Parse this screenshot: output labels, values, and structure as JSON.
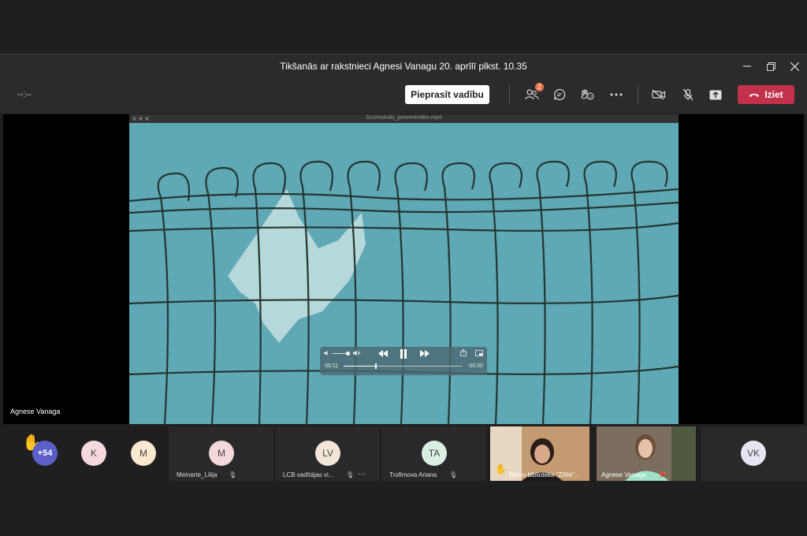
{
  "window": {
    "title": "Tikšanās ar rakstnieci Agnesi Vanagu 20. aprīlī plkst. 10.35"
  },
  "toolbar": {
    "timer": "--:--",
    "request_control_label": "Pieprasīt vadību",
    "participants_badge": "2",
    "leave_label": "Iziet"
  },
  "stage": {
    "video_filename": "Duzmukulis_prezentvideo.mp4",
    "elapsed": "00:11",
    "remaining": "-00:30",
    "progress": 0.27,
    "presenter_name": "Agnese Vanaga"
  },
  "participants": {
    "overflow_count": "+54",
    "tiles": [
      {
        "initials": "K"
      },
      {
        "initials": "M"
      },
      {
        "initials": "M",
        "name": "Meinerte_Lilija"
      },
      {
        "initials": "LV",
        "name": "LCB vadītājas vi..."
      },
      {
        "initials": "TA",
        "name": "Trofimova Ariana"
      },
      {
        "initials": "",
        "name": "Bērnu bibliotēka \"Zīlīte\"..."
      },
      {
        "initials": "",
        "name": "Agnese Vanaga"
      },
      {
        "initials": "VK"
      }
    ]
  },
  "colors": {
    "leave": "#c4314b",
    "badge": "#e8734a",
    "overflow_avatar": "#5b5fc7"
  }
}
